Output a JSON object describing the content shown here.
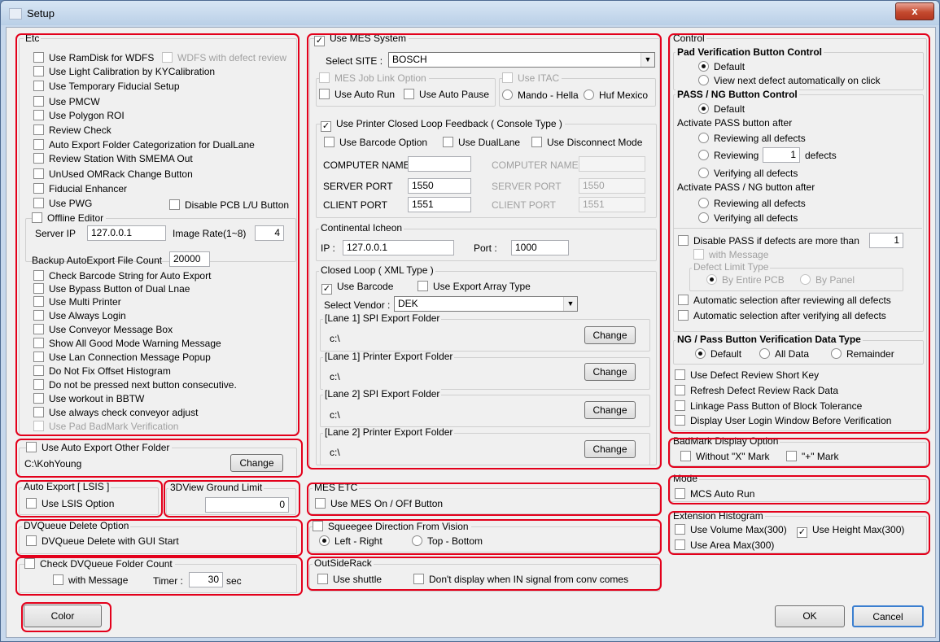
{
  "window": {
    "title": "Setup",
    "close_label": "x"
  },
  "etc": {
    "title": "Etc",
    "items": [
      "Use RamDisk for WDFS",
      "Use Light Calibration by KYCalibration",
      "Use Temporary Fiducial Setup",
      "Use PMCW",
      "Use Polygon ROI",
      "Review Check",
      "Auto Export Folder Categorization for DualLane",
      "Review Station With SMEMA Out",
      "UnUsed OMRack Change Button",
      "Fiducial Enhancer",
      "Use PWG"
    ],
    "wdfs_defect_review": "WDFS with defect review",
    "disable_pcb_lu": "Disable PCB L/U Button",
    "offline_editor": "Offline Editor",
    "server_ip_label": "Server IP",
    "server_ip": "127.0.0.1",
    "image_rate_label": "Image Rate(1~8)",
    "image_rate": "4",
    "backup_label": "Backup AutoExport File Count",
    "backup_value": "20000",
    "items2": [
      "Check Barcode String for Auto Export",
      "Use Bypass Button of Dual Lnae",
      "Use Multi Printer",
      "Use Always Login",
      "Use Conveyor Message Box",
      "Show All Good Mode Warning Message",
      "Use Lan Connection Message Popup",
      "Do Not Fix Offset Histogram",
      "Do not be pressed next button consecutive.",
      "Use workout in BBTW",
      "Use always check conveyor adjust"
    ],
    "pad_badmark": "Use Pad BadMark Verification"
  },
  "auto_export_other": {
    "label": "Use Auto Export Other Folder",
    "path": "C:\\KohYoung",
    "change": "Change"
  },
  "auto_export_lsis": {
    "title": "Auto Export [ LSIS ]",
    "option": "Use LSIS Option"
  },
  "view3d": {
    "title": "3DView Ground Limit",
    "value": "0"
  },
  "dvqueue_delete": {
    "title": "DVQueue Delete Option",
    "option": "DVQueue Delete with GUI Start"
  },
  "dvqueue_count": {
    "title": "Check DVQueue Folder Count",
    "with_message": "with Message",
    "timer_label": "Timer :",
    "timer_value": "30",
    "unit": "sec"
  },
  "color_button": "Color",
  "mes": {
    "title": "Use MES System",
    "site_label": "Select SITE :",
    "site_value": "BOSCH",
    "job_link": "MES Job Link Option",
    "auto_run": "Use Auto Run",
    "auto_pause": "Use Auto Pause",
    "itac": "Use ITAC",
    "mando": "Mando - Hella",
    "huf": "Huf Mexico",
    "printer_loop": "Use Printer Closed Loop Feedback ( Console Type )",
    "barcode_option": "Use Barcode Option",
    "dual_lane": "Use DualLane",
    "disconnect_mode": "Use Disconnect Mode",
    "computer_name": "COMPUTER NAME",
    "server_port": "SERVER  PORT",
    "client_port": "CLIENT  PORT",
    "server_port_value": "1550",
    "client_port_value": "1551",
    "server_port_value2": "1550",
    "client_port_value2": "1551",
    "continental": "Continental Icheon",
    "ip_label": "IP :",
    "ip_value": "127.0.0.1",
    "port_label": "Port :",
    "port_value": "1000",
    "closed_loop": "Closed Loop ( XML Type )",
    "use_barcode": "Use Barcode",
    "export_array": "Use Export Array Type",
    "vendor_label": "Select Vendor :",
    "vendor_value": "DEK",
    "lanes": [
      {
        "title": "[Lane 1] SPI Export Folder",
        "path": "c:\\"
      },
      {
        "title": "[Lane 1] Printer Export Folder",
        "path": "c:\\"
      },
      {
        "title": "[Lane 2] SPI Export Folder",
        "path": "c:\\"
      },
      {
        "title": "[Lane 2] Printer Export Folder",
        "path": "c:\\"
      }
    ],
    "change": "Change"
  },
  "mes_etc": {
    "title": "MES ETC",
    "option": "Use MES On / OFf Button"
  },
  "squeegee": {
    "title": "Squeegee Direction From Vision",
    "left_right": "Left - Right",
    "top_bottom": "Top - Bottom"
  },
  "outside_rack": {
    "title": "OutSideRack",
    "shuttle": "Use shuttle",
    "dont_display": "Don't display when IN signal from conv comes"
  },
  "control": {
    "title": "Control",
    "pad_title": "Pad Verification Button Control",
    "pad_default": "Default",
    "pad_next": "View next defect automatically on click",
    "pass_title": "PASS / NG Button Control",
    "pass_default": "Default",
    "activate_pass": "Activate PASS button after",
    "reviewing_all": "Reviewing all defects",
    "reviewing": "Reviewing",
    "reviewing_value": "1",
    "defects": "defects",
    "verifying_all": "Verifying all defects",
    "activate_pass_ng": "Activate PASS / NG button after",
    "reviewing_all2": "Reviewing all defects",
    "verifying_all2": "Verifying all defects",
    "disable_pass": "Disable PASS if defects are more than",
    "disable_value": "1",
    "with_message": "with Message",
    "defect_limit": "Defect Limit Type",
    "by_pcb": "By Entire PCB",
    "by_panel": "By Panel",
    "auto_review": "Automatic selection after reviewing all defects",
    "auto_verify": "Automatic selection after verifying all defects",
    "ng_title": "NG / Pass Button Verification Data Type",
    "ng_default": "Default",
    "all_data": "All Data",
    "remainder": "Remainder",
    "short_key": "Use Defect Review Short Key",
    "refresh": "Refresh Defect Review Rack Data",
    "linkage": "Linkage Pass Button of  Block Tolerance",
    "login": "Display User Login Window Before Verification"
  },
  "badmark": {
    "title": "BadMark Display Option",
    "without_x": "Without \"X\" Mark",
    "plus": "\"+\" Mark"
  },
  "mode": {
    "title": "Mode",
    "mcs": "MCS Auto Run"
  },
  "histogram": {
    "title": "Extension Histogram",
    "volume": "Use Volume Max(300)",
    "height": "Use Height Max(300)",
    "area": "Use Area Max(300)"
  },
  "buttons": {
    "ok": "OK",
    "cancel": "Cancel"
  }
}
